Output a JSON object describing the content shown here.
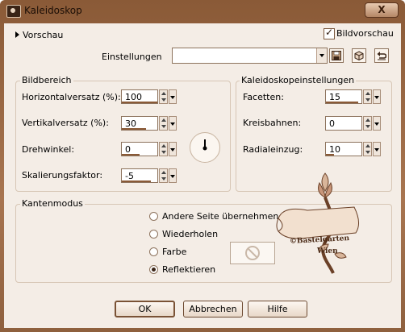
{
  "window": {
    "title": "Kaleidoskop",
    "close_glyph": "X"
  },
  "preview": {
    "label": "Vorschau",
    "show_preview_label": "Bildvorschau",
    "show_preview_checked": true
  },
  "settings": {
    "label": "Einstellungen",
    "value": ""
  },
  "image_area": {
    "title": "Bildbereich",
    "fields": [
      {
        "label": "Horizontalversatz (%):",
        "value": "100"
      },
      {
        "label": "Vertikalversatz (%):",
        "value": "30"
      },
      {
        "label": "Drehwinkel:",
        "value": "0"
      },
      {
        "label": "Skalierungsfaktor:",
        "value": "-5"
      }
    ]
  },
  "kaleidoscope": {
    "title": "Kaleidoskopeinstellungen",
    "fields": [
      {
        "label": "Facetten:",
        "value": "15"
      },
      {
        "label": "Kreisbahnen:",
        "value": "0"
      },
      {
        "label": "Radialeinzug:",
        "value": "10"
      }
    ]
  },
  "edge_mode": {
    "title": "Kantenmodus",
    "options": [
      {
        "label": "Andere Seite übernehmen",
        "selected": false
      },
      {
        "label": "Wiederholen",
        "selected": false
      },
      {
        "label": "Farbe",
        "selected": false
      },
      {
        "label": "Reflektieren",
        "selected": true
      }
    ]
  },
  "watermark": {
    "line1": "©Bastelgarten",
    "line2": "Wien"
  },
  "buttons": {
    "ok": "OK",
    "cancel": "Abbrechen",
    "help": "Hilfe"
  },
  "colors": {
    "frame": "#a87550",
    "panel": "#f4ede6",
    "accent": "#8a5a37"
  }
}
